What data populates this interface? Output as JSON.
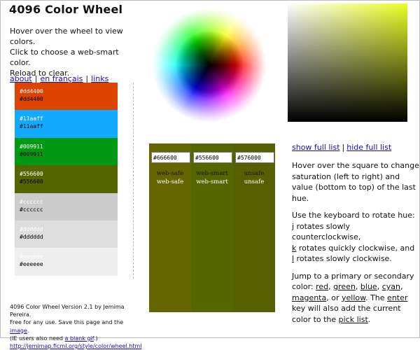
{
  "page": {
    "title": "4096 Color Wheel"
  },
  "intro": {
    "line1": "Hover over the wheel to view colors.",
    "line2": "Click to choose a web-smart color.",
    "line3": "Reload to clear."
  },
  "nav": {
    "about": "about",
    "french": "en français",
    "links": "links"
  },
  "swatches": [
    {
      "top": "#dd4400",
      "bottom": "#dd4400",
      "color": "#dd4400"
    },
    {
      "top": "#11aaff",
      "bottom": "#11aaff",
      "color": "#11aaff"
    },
    {
      "top": "#009911",
      "bottom": "#009911",
      "color": "#009911"
    },
    {
      "top": "#556600",
      "bottom": "#556600",
      "color": "#556600"
    },
    {
      "top": "#cccccc",
      "bottom": "#cccccc",
      "color": "#cccccc"
    },
    {
      "top": "#dddddd",
      "bottom": "#dddddd",
      "color": "#dddddd"
    },
    {
      "top": "#eeeeee",
      "bottom": "#eeeeee",
      "color": "#eeeeee"
    }
  ],
  "compare": [
    {
      "value": "#666600",
      "label_a": "web-safe",
      "label_b": "web-safe",
      "color": "#666600"
    },
    {
      "value": "#556600",
      "label_a": "web-smart",
      "label_b": "web-smart",
      "color": "#556600"
    },
    {
      "value": "#576000",
      "label_a": "unsafe",
      "label_b": "unsafe",
      "color": "#576000"
    }
  ],
  "list_links": {
    "show": "show full list",
    "hide": "hide full list"
  },
  "help": {
    "p1": "Hover over the square to change saturation (left to right) and value (bottom to top) of the last hue.",
    "p2_lead": "Use the keyboard to rotate hue:",
    "k1": "j",
    "k1_text": " rotates slowly counterclockwise,",
    "k2": "k",
    "k2_text": " rotates quickly clockwise, and",
    "k3": "l",
    "k3_text": " rotates slowly clockwise.",
    "p3_lead": "Jump to a primary or secondary color: ",
    "red": "red",
    "green": "green",
    "blue": "blue",
    "cyan": "cyan",
    "magenta": "magenta",
    "yellow": "yellow",
    "p3_mid": ". The ",
    "enter": "enter",
    "p3_tail": " key will also add the current color to the ",
    "pick": "pick list",
    "p3_end": "."
  },
  "footer": {
    "line1": "4096 Color Wheel Version 2.1 by Jemima Pereira.",
    "line2a": "Free for any use. Save this page and the ",
    "image": "image",
    "line2b": ".",
    "line3a": "(IE users also need ",
    "blank": "a blank gif",
    "line3b": ".)",
    "url": "http://jemimap.ficml.org/style/color/wheel.html"
  }
}
